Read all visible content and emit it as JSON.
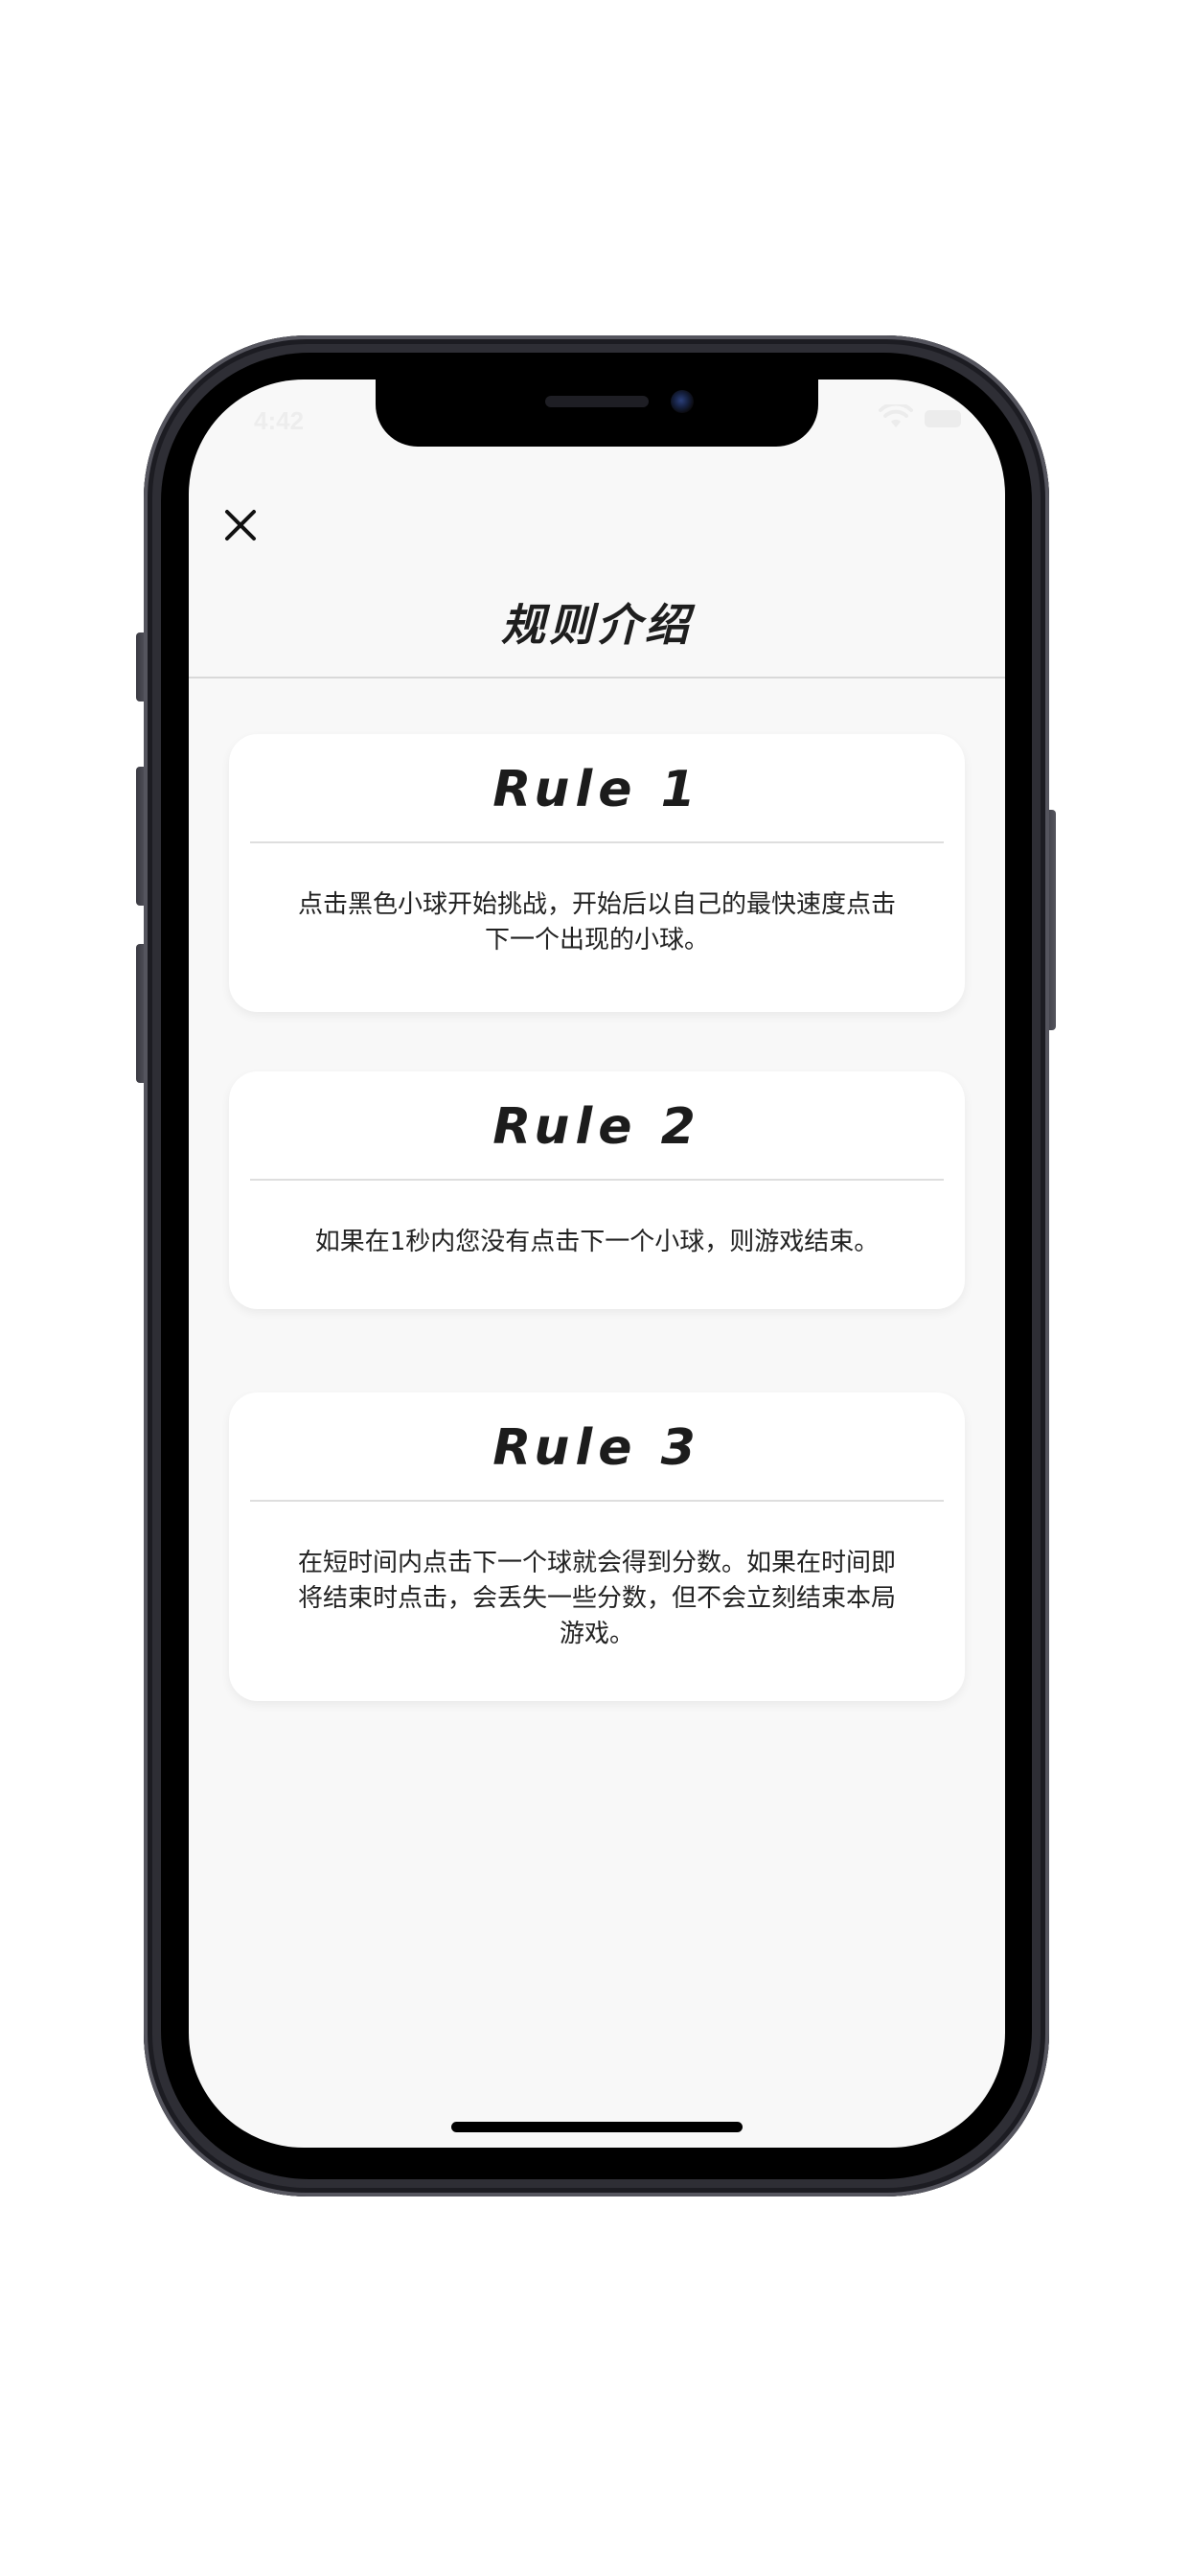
{
  "status_bar": {
    "time": "4:42",
    "wifi_icon": "wifi-icon",
    "battery_icon": "battery-icon"
  },
  "header": {
    "close_icon": "close-icon",
    "title": "规则介绍"
  },
  "rules": [
    {
      "title": "Rule  1",
      "text": "点击黑色小球开始挑战，开始后以自己的最快速度点击下一个出现的小球。"
    },
    {
      "title": "Rule  2",
      "text": "如果在1秒内您没有点击下一个小球，则游戏结束。"
    },
    {
      "title": "Rule  3",
      "text": "在短时间内点击下一个球就会得到分数。如果在时间即将结束时点击，会丢失一些分数，但不会立刻结束本局游戏。"
    }
  ],
  "colors": {
    "screen_background": "#f8f8f8",
    "card_background": "#ffffff",
    "text": "#222222",
    "divider": "#dedede"
  }
}
